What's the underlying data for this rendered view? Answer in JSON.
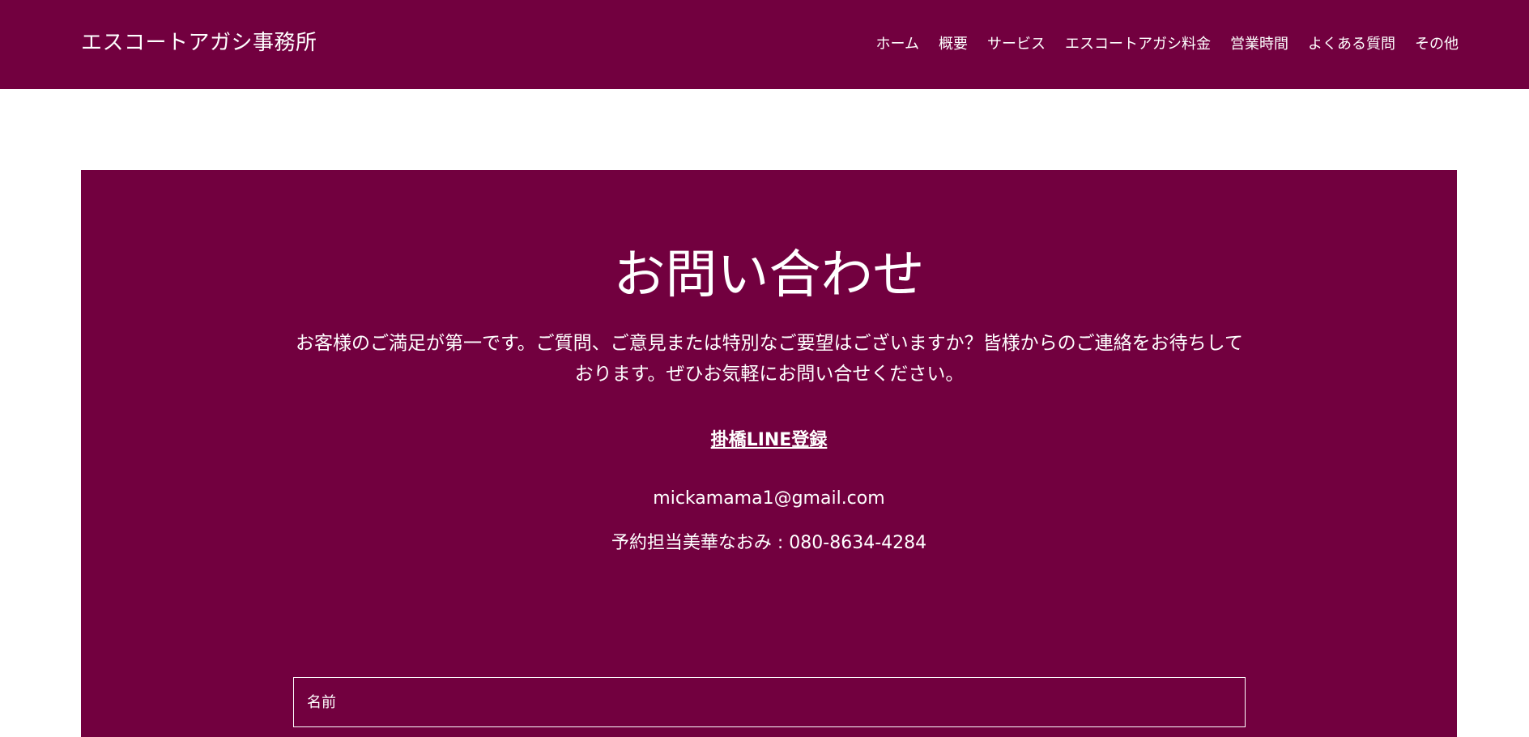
{
  "header": {
    "site_title": "エスコートアガシ事務所",
    "nav": [
      "ホーム",
      "概要",
      "サービス",
      "エスコートアガシ料金",
      "営業時間",
      "よくある質問",
      "その他"
    ]
  },
  "contact": {
    "heading": "お問い合わせ",
    "description": "お客様のご満足が第一です。ご質問、ご意見または特別なご要望はございますか？皆様からのご連絡をお待ちしております。ぜひお気軽にお問い合せください。",
    "line_link": "掛橋LINE登録",
    "email": "mickamama1@gmail.com",
    "phone": "予約担当美華なおみ : 080-8634-4284",
    "form": {
      "name_label": "名前"
    }
  },
  "colors": {
    "brand": "#72003f",
    "text": "#ffffff"
  }
}
